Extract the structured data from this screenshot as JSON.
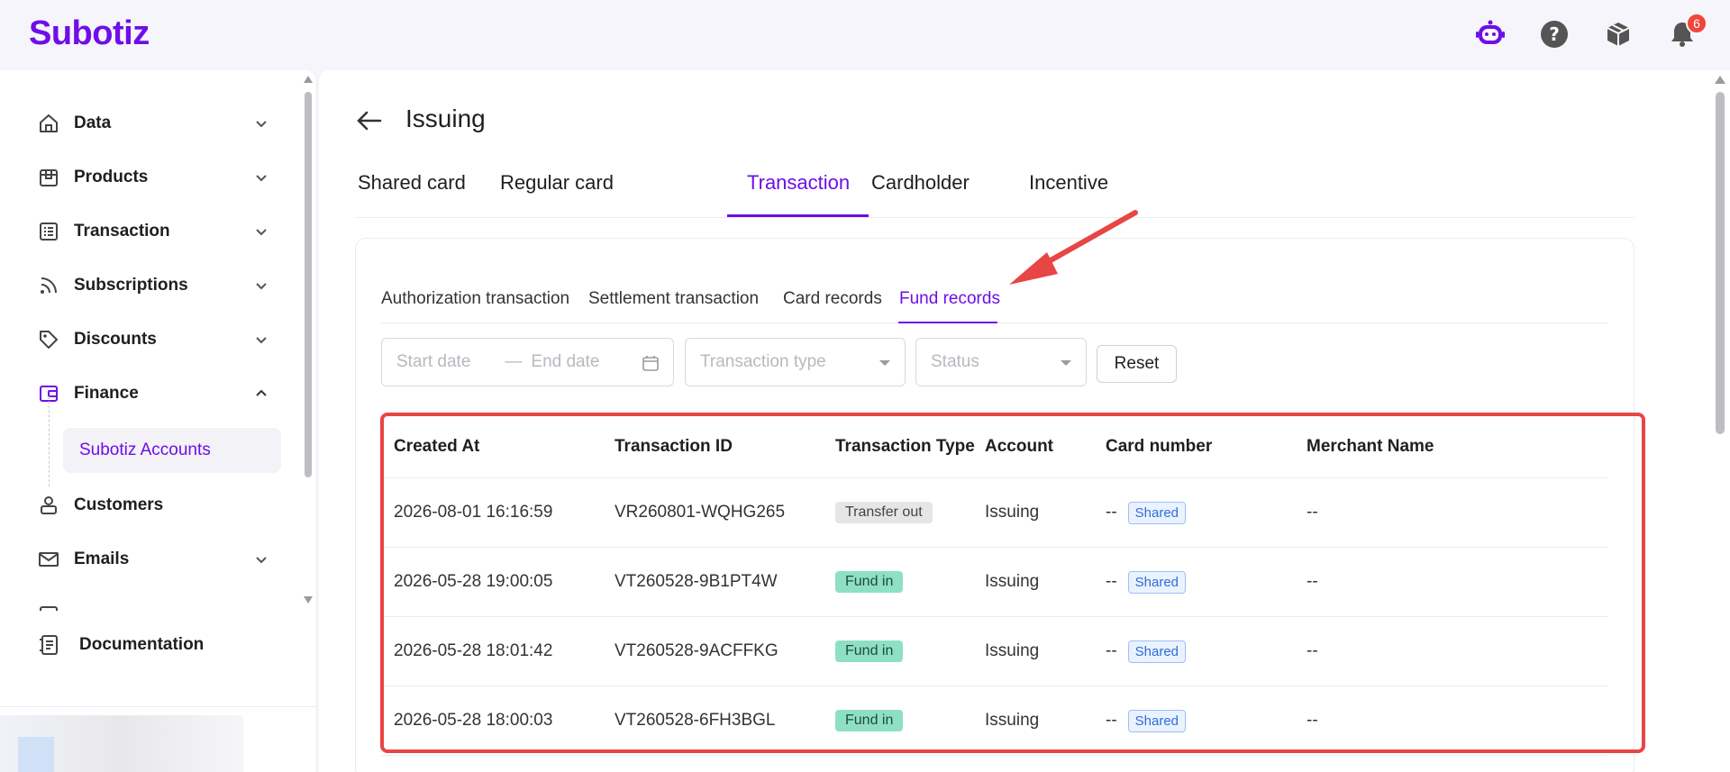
{
  "brand": {
    "logo": "Subotiz",
    "accent": "#6e0ee8"
  },
  "topbar": {
    "icons": [
      "bot-icon",
      "help-icon",
      "box-icon",
      "bell-icon"
    ],
    "notification_count": "6"
  },
  "sidebar": {
    "items": [
      {
        "label": "Data",
        "icon": "home-icon",
        "expanded": false
      },
      {
        "label": "Products",
        "icon": "store-icon",
        "expanded": false
      },
      {
        "label": "Transaction",
        "icon": "list-icon",
        "expanded": false
      },
      {
        "label": "Subscriptions",
        "icon": "rss-icon",
        "expanded": false
      },
      {
        "label": "Discounts",
        "icon": "tag-icon",
        "expanded": false
      },
      {
        "label": "Finance",
        "icon": "wallet-icon",
        "expanded": true
      },
      {
        "label": "Customers",
        "icon": "user-icon",
        "expanded": false
      },
      {
        "label": "Emails",
        "icon": "mail-icon",
        "expanded": false
      }
    ],
    "active_sub_item": "Subotiz Accounts",
    "documentation": "Documentation"
  },
  "page": {
    "title": "Issuing",
    "tabs": [
      "Shared card",
      "Regular card",
      "Transaction",
      "Cardholder",
      "Incentive"
    ],
    "active_tab": "Transaction",
    "subtabs": [
      "Authorization transaction",
      "Settlement transaction",
      "Card records",
      "Fund records"
    ],
    "active_subtab": "Fund records"
  },
  "filters": {
    "start_date_placeholder": "Start date",
    "date_separator": "—",
    "end_date_placeholder": "End date",
    "transaction_type_placeholder": "Transaction type",
    "status_placeholder": "Status",
    "reset_label": "Reset"
  },
  "table": {
    "columns": [
      "Created At",
      "Transaction ID",
      "Transaction Type",
      "Account",
      "Card number",
      "Merchant Name"
    ],
    "rows": [
      {
        "created_at": "2026-08-01 16:16:59",
        "transaction_id": "VR260801-WQHG265",
        "type": "Transfer out",
        "account": "Issuing",
        "card_number": "--",
        "card_tag": "Shared",
        "merchant": "--"
      },
      {
        "created_at": "2026-05-28 19:00:05",
        "transaction_id": "VT260528-9B1PT4W",
        "type": "Fund in",
        "account": "Issuing",
        "card_number": "--",
        "card_tag": "Shared",
        "merchant": "--"
      },
      {
        "created_at": "2026-05-28 18:01:42",
        "transaction_id": "VT260528-9ACFFKG",
        "type": "Fund in",
        "account": "Issuing",
        "card_number": "--",
        "card_tag": "Shared",
        "merchant": "--"
      },
      {
        "created_at": "2026-05-28 18:00:03",
        "transaction_id": "VT260528-6FH3BGL",
        "type": "Fund in",
        "account": "Issuing",
        "card_number": "--",
        "card_tag": "Shared",
        "merchant": "--"
      }
    ]
  },
  "colors": {
    "highlight": "#e84545",
    "fund_in_tag": "#8ee0c5",
    "transfer_out_tag": "#e6e6e6",
    "shared_tag": "#2e6fd6"
  }
}
